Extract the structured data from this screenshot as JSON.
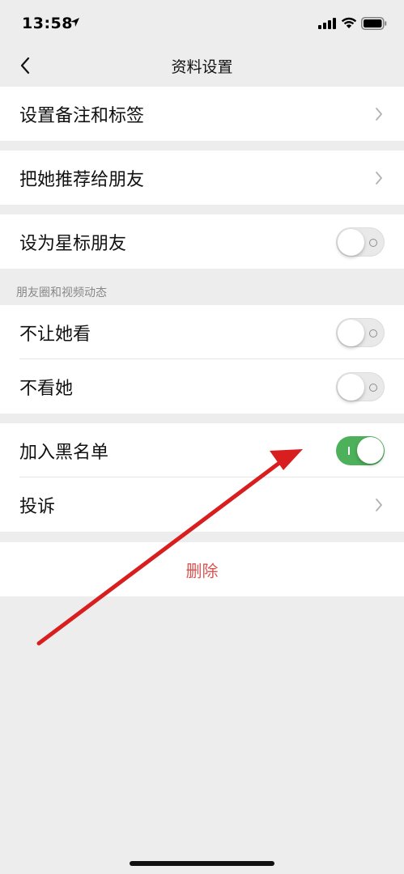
{
  "status_bar": {
    "time": "13:58"
  },
  "nav": {
    "title": "资料设置"
  },
  "rows": {
    "set_remark": "设置备注和标签",
    "recommend": "把她推荐给朋友",
    "star_friend": "设为星标朋友",
    "moments_header": "朋友圈和视频动态",
    "hide_mine": "不让她看",
    "hide_hers": "不看她",
    "blacklist": "加入黑名单",
    "report": "投诉",
    "delete": "删除"
  },
  "toggles": {
    "star_friend": false,
    "hide_mine": false,
    "hide_hers": false,
    "blacklist": true
  },
  "colors": {
    "toggle_on": "#4db05a",
    "delete_text": "#d9534f",
    "annotation_arrow": "#d81e1e",
    "background": "#ededed"
  }
}
